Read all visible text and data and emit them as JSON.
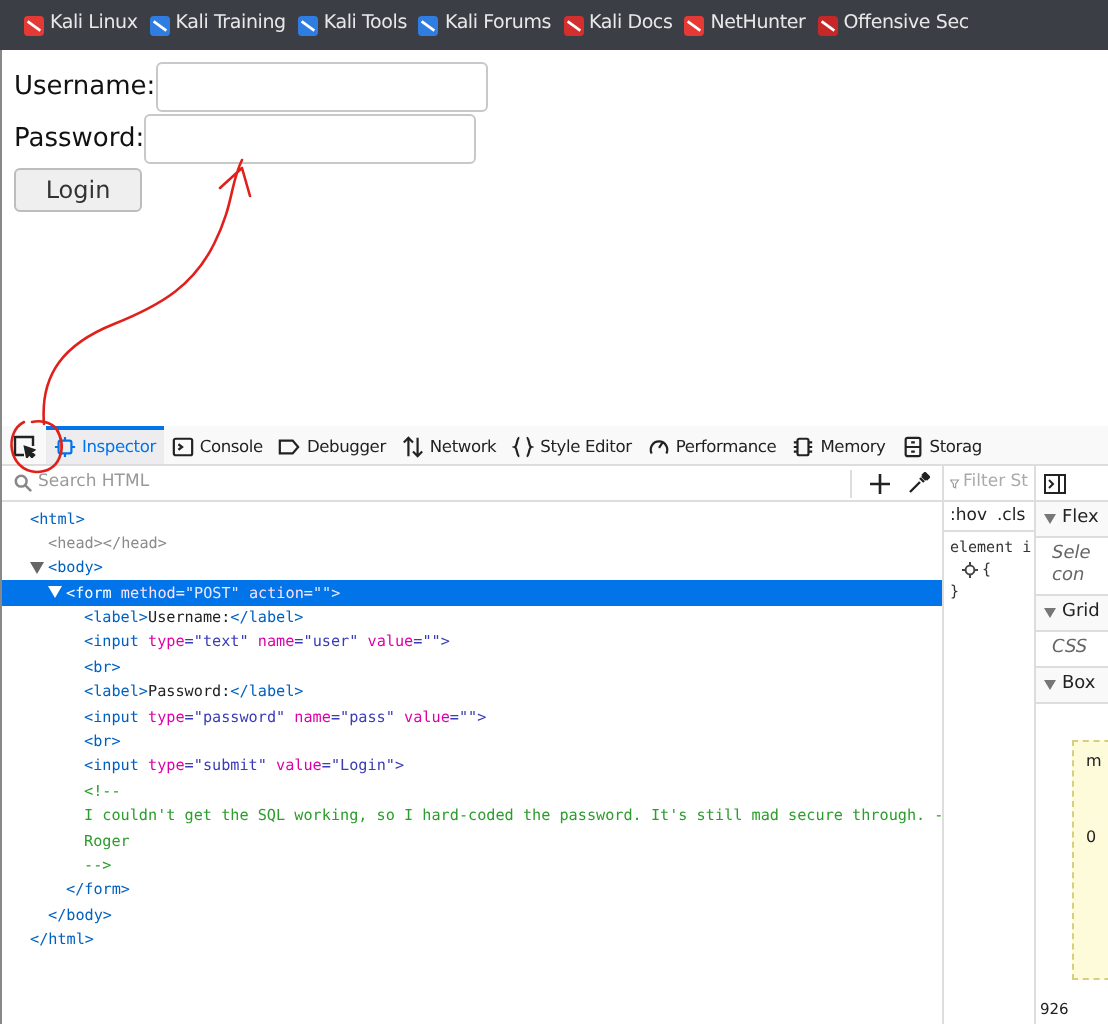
{
  "bookmarks": [
    {
      "label": "Kali Linux",
      "color": "#e53935"
    },
    {
      "label": "Kali Training",
      "color": "#2f7de1"
    },
    {
      "label": "Kali Tools",
      "color": "#2f7de1"
    },
    {
      "label": "Kali Forums",
      "color": "#2f7de1"
    },
    {
      "label": "Kali Docs",
      "color": "#d32f2f"
    },
    {
      "label": "NetHunter",
      "color": "#e53935"
    },
    {
      "label": "Offensive Sec",
      "color": "#c62828"
    }
  ],
  "form": {
    "fields": [
      {
        "label": "Username:"
      },
      {
        "label": "Password:"
      }
    ],
    "button": "Login"
  },
  "devtools": {
    "tabs": [
      {
        "label": "Inspector",
        "selected": true
      },
      {
        "label": "Console",
        "selected": false
      },
      {
        "label": "Debugger",
        "selected": false
      },
      {
        "label": "Network",
        "selected": false
      },
      {
        "label": "Style Editor",
        "selected": false
      },
      {
        "label": "Performance",
        "selected": false
      },
      {
        "label": "Memory",
        "selected": false
      },
      {
        "label": "Storag",
        "selected": false
      }
    ],
    "search": {
      "placeholder": "Search HTML"
    },
    "markup": [
      {
        "open": [
          {
            "kind": "tag",
            "text": "<html>"
          }
        ],
        "selected": false,
        "children": [
          {
            "open": [
              {
                "kind": "muted",
                "text": "<head></head>"
              }
            ],
            "selected": false
          },
          {
            "open": [
              {
                "kind": "tag",
                "text": "<body>"
              }
            ],
            "expanded": true,
            "selected": false,
            "children": [
              {
                "open": [
                  {
                    "kind": "tag",
                    "text": "<form"
                  },
                  {
                    "kind": "attr",
                    "text": " method"
                  },
                  {
                    "kind": "value",
                    "text": "=\"POST\""
                  },
                  {
                    "kind": "attr",
                    "text": " action"
                  },
                  {
                    "kind": "value",
                    "text": "=\"\">"
                  }
                ],
                "expanded": true,
                "selected": true,
                "children": [
                  {
                    "open": [
                      {
                        "kind": "tag",
                        "text": "<label>"
                      },
                      {
                        "kind": "text",
                        "text": "Username:"
                      },
                      {
                        "kind": "tag",
                        "text": "</label>"
                      }
                    ],
                    "selected": false
                  },
                  {
                    "open": [
                      {
                        "kind": "tag",
                        "text": "<input"
                      },
                      {
                        "kind": "attr",
                        "text": " type"
                      },
                      {
                        "kind": "value",
                        "text": "=\"text\""
                      },
                      {
                        "kind": "attr",
                        "text": " name"
                      },
                      {
                        "kind": "value",
                        "text": "=\"user\""
                      },
                      {
                        "kind": "attr",
                        "text": " value"
                      },
                      {
                        "kind": "value",
                        "text": "=\"\">"
                      }
                    ],
                    "selected": false
                  },
                  {
                    "open": [
                      {
                        "kind": "tag",
                        "text": "<br>"
                      }
                    ],
                    "selected": false
                  },
                  {
                    "open": [
                      {
                        "kind": "tag",
                        "text": "<label>"
                      },
                      {
                        "kind": "text",
                        "text": "Password:"
                      },
                      {
                        "kind": "tag",
                        "text": "</label>"
                      }
                    ],
                    "selected": false
                  },
                  {
                    "open": [
                      {
                        "kind": "tag",
                        "text": "<input"
                      },
                      {
                        "kind": "attr",
                        "text": " type"
                      },
                      {
                        "kind": "value",
                        "text": "=\"password\""
                      },
                      {
                        "kind": "attr",
                        "text": " name"
                      },
                      {
                        "kind": "value",
                        "text": "=\"pass\""
                      },
                      {
                        "kind": "attr",
                        "text": " value"
                      },
                      {
                        "kind": "value",
                        "text": "=\"\">"
                      }
                    ],
                    "selected": false
                  },
                  {
                    "open": [
                      {
                        "kind": "tag",
                        "text": "<br>"
                      }
                    ],
                    "selected": false
                  },
                  {
                    "open": [
                      {
                        "kind": "tag",
                        "text": "<input"
                      },
                      {
                        "kind": "attr",
                        "text": " type"
                      },
                      {
                        "kind": "value",
                        "text": "=\"submit\""
                      },
                      {
                        "kind": "attr",
                        "text": " value"
                      },
                      {
                        "kind": "value",
                        "text": "=\"Login\">"
                      }
                    ],
                    "selected": false
                  },
                  {
                    "open": [
                      {
                        "kind": "comment",
                        "text": "<!--"
                      }
                    ],
                    "selected": false
                  },
                  {
                    "open": [
                      {
                        "kind": "comment",
                        "text": "I couldn't get the SQL working, so I hard-coded the password. It's still mad secure through. -"
                      }
                    ],
                    "selected": false
                  },
                  {
                    "open": [
                      {
                        "kind": "comment",
                        "text": "Roger"
                      }
                    ],
                    "selected": false
                  },
                  {
                    "open": [
                      {
                        "kind": "comment",
                        "text": "-->"
                      }
                    ],
                    "selected": false
                  }
                ],
                "close": [
                  {
                    "kind": "tag",
                    "text": "</form>"
                  }
                ]
              }
            ],
            "close": [
              {
                "kind": "tag",
                "text": "</body>"
              }
            ]
          }
        ],
        "close": [
          {
            "kind": "tag",
            "text": "</html>"
          }
        ]
      }
    ],
    "rules": {
      "filter_placeholder": "Filter St",
      "toggles": [
        ":hov",
        ".cls"
      ],
      "lines": [
        "element i",
        "{",
        "}"
      ]
    },
    "layout": {
      "sections": [
        {
          "title": "Flex",
          "lines": [
            "Sele",
            "con"
          ]
        },
        {
          "title": "Grid",
          "lines": [
            "CSS"
          ]
        },
        {
          "title": "Box"
        }
      ],
      "box_labels": [
        "m",
        "0"
      ],
      "size": "926"
    }
  }
}
